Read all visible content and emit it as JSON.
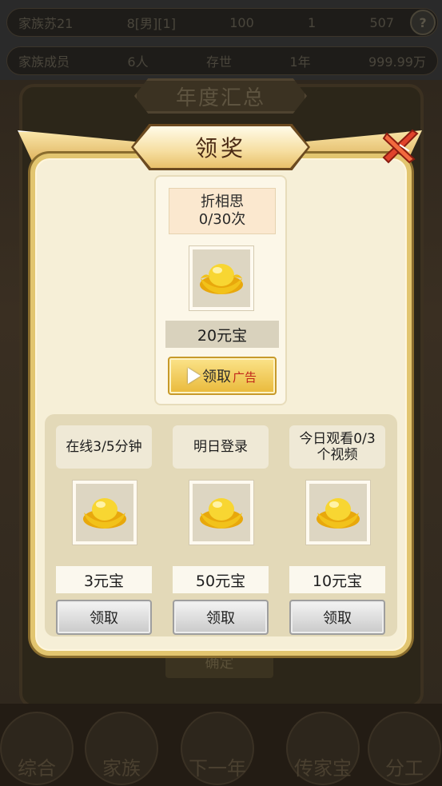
{
  "background": {
    "family_name": "家族苏21",
    "family_slot": "8[男][1]",
    "stat_a": "100",
    "stat_b": "1",
    "stat_c": "507",
    "members_label": "家族成员",
    "members_value": "6人",
    "generation_label": "存世",
    "generation_value": "1年",
    "money": "999.99万",
    "behind_title": "年度汇总",
    "behind_confirm": "确定",
    "nav": [
      "综合",
      "家族",
      "下一年",
      "传家宝",
      "分工"
    ]
  },
  "dialog": {
    "title": "领奖",
    "main_reward": {
      "task_line1": "折相思",
      "task_line2": "0/30次",
      "amount": "20元宝",
      "button_label": "领取",
      "ad_tag": "广告"
    },
    "rewards": [
      {
        "task": "在线3/5分钟",
        "amount": "3元宝",
        "button": "领取"
      },
      {
        "task": "明日登录",
        "amount": "50元宝",
        "button": "领取"
      },
      {
        "task": "今日观看0/3个视频",
        "amount": "10元宝",
        "button": "领取"
      }
    ]
  },
  "colors": {
    "gold": "#e9b93a",
    "cream": "#f6efd7",
    "ad_red": "#c0251a"
  },
  "icons": {
    "reward": "gold-ingot-icon",
    "close": "close-icon",
    "play": "play-icon"
  }
}
